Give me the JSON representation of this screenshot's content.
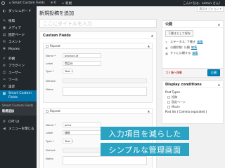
{
  "admin_bar": {
    "site_name": "Smart Custom Fields",
    "comments_count": "0",
    "new_label": "+ 新規",
    "greeting": "こんにちは、admin さん！"
  },
  "sidebar": {
    "items": [
      {
        "label": "ダッシュボード",
        "icon": "dashboard-icon",
        "glyph": "◐"
      },
      {
        "label": "投稿",
        "icon": "pin-icon",
        "glyph": "✎"
      },
      {
        "label": "メディア",
        "icon": "media-icon",
        "glyph": "▣"
      },
      {
        "label": "固定ページ",
        "icon": "page-icon",
        "glyph": "▤"
      },
      {
        "label": "コメント",
        "icon": "comment-icon",
        "glyph": "✉"
      },
      {
        "label": "Movies",
        "icon": "movies-icon",
        "glyph": "✱"
      },
      {
        "label": "外観",
        "icon": "appearance-icon",
        "glyph": "✐"
      },
      {
        "label": "プラグイン",
        "icon": "plugin-icon",
        "glyph": "⚙"
      },
      {
        "label": "ユーザー",
        "icon": "user-icon",
        "glyph": "☺"
      },
      {
        "label": "ツール",
        "icon": "tool-icon",
        "glyph": "✂"
      },
      {
        "label": "設定",
        "icon": "settings-icon",
        "glyph": "⚒"
      }
    ],
    "current": {
      "label": "Smart Custom Fields",
      "icon": "grid-icon",
      "glyph": "▦"
    },
    "sub_items": [
      "Smart Custom Fields",
      "新規追加"
    ],
    "bottom_items": [
      {
        "label": "CPT UI",
        "icon": "cpt-icon",
        "glyph": "⚙"
      },
      {
        "label": "メニューを閉じる",
        "icon": "collapse-icon",
        "glyph": "◀"
      }
    ]
  },
  "page": {
    "title": "新規投稿を追加",
    "screen_options": "表示オプション ▾",
    "title_placeholder": "ここにタイトルを入力"
  },
  "custom_fields": {
    "header": "Custom Fields",
    "arrow": "▲",
    "groups": [
      {
        "repeat_label": "Repeat",
        "fields": [
          {
            "label": "Name *",
            "value": "product-id"
          },
          {
            "label": "Label",
            "value": "商品ID"
          },
          {
            "label": "Type *",
            "value": "Text"
          },
          {
            "label": "Default",
            "value": ""
          },
          {
            "label": "Notes",
            "value": ""
          }
        ]
      },
      {
        "repeat_label": "Repeat",
        "fields": [
          {
            "label": "Name *",
            "value": "price"
          },
          {
            "label": "Label",
            "value": "価格"
          },
          {
            "label": "Type *",
            "value": "Text"
          },
          {
            "label": "Default",
            "value": ""
          },
          {
            "label": "Notes",
            "value": ""
          }
        ]
      }
    ]
  },
  "publish": {
    "header": "公開",
    "save_draft": "下書きとして保存",
    "status_label": "ステータス: 下書き",
    "visibility_label": "公開状態: 公開",
    "schedule_label": "すぐに公開する",
    "edit_link": "編集",
    "trash_label": "ゴミ箱へ移動",
    "publish_label": "公開"
  },
  "display_conditions": {
    "header": "Display conditions",
    "post_types_label": "Post Types",
    "post_types": [
      "投稿",
      "固定ページ",
      "Movie"
    ],
    "post_ids_label": "Post Ids ( Comma separated )"
  },
  "caption": {
    "line1": "入力項目を減らした",
    "line2": "シンプルな管理画面"
  }
}
